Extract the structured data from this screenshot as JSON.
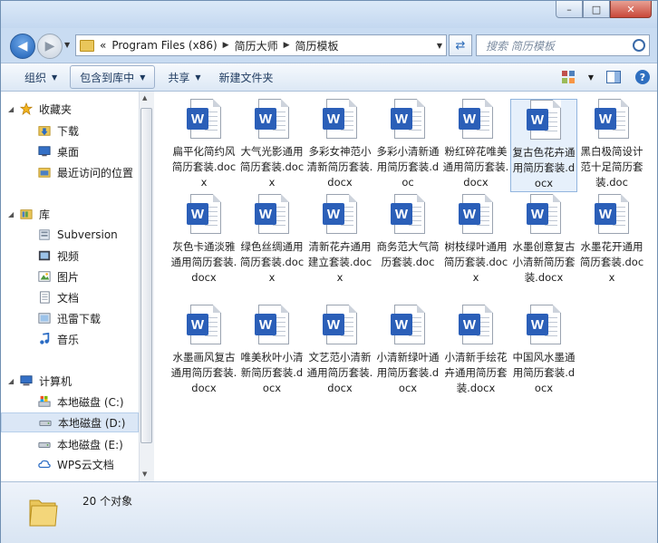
{
  "window": {
    "min_glyph": "–",
    "max_glyph": "□",
    "close_glyph": "✕"
  },
  "address": {
    "prefix": "«",
    "crumbs": [
      "Program Files (x86)",
      "简历大师",
      "简历模板"
    ]
  },
  "search": {
    "placeholder": "搜索 简历模板"
  },
  "toolbar": {
    "organize": "组织",
    "include_library": "包含到库中",
    "share": "共享",
    "new_folder": "新建文件夹"
  },
  "sidebar": {
    "favorites": "收藏夹",
    "downloads": "下载",
    "desktop": "桌面",
    "recent": "最近访问的位置",
    "libraries": "库",
    "subversion": "Subversion",
    "videos": "视频",
    "pictures": "图片",
    "documents": "文档",
    "xunlei": "迅雷下载",
    "music": "音乐",
    "computer": "计算机",
    "disk_c": "本地磁盘 (C:)",
    "disk_d": "本地磁盘 (D:)",
    "disk_e": "本地磁盘 (E:)",
    "wps": "WPS云文档"
  },
  "files": [
    "扁平化简约风简历套装.docx",
    "大气光影通用简历套装.docx",
    "多彩女神范小清新简历套装.docx",
    "多彩小清新通用简历套装.doc",
    "粉红碎花唯美通用简历套装.docx",
    "复古色花卉通用简历套装.docx",
    "黑白极简设计范十足简历套装.doc",
    "灰色卡通淡雅通用简历套装.docx",
    "绿色丝绸通用简历套装.docx",
    "清新花卉通用建立套装.docx",
    "商务范大气简历套装.doc",
    "树枝绿叶通用简历套装.docx",
    "水墨创意复古小清新简历套装.docx",
    "水墨花开通用简历套装.docx",
    "水墨画风复古通用简历套装.docx",
    "唯美秋叶小清新简历套装.docx",
    "文艺范小清新通用简历套装.docx",
    "小清新绿叶通用简历套装.docx",
    "小清新手绘花卉通用简历套装.docx",
    "中国风水墨通用简历套装.docx"
  ],
  "file_icon_letter": "W",
  "status": {
    "count": "20 个对象"
  }
}
